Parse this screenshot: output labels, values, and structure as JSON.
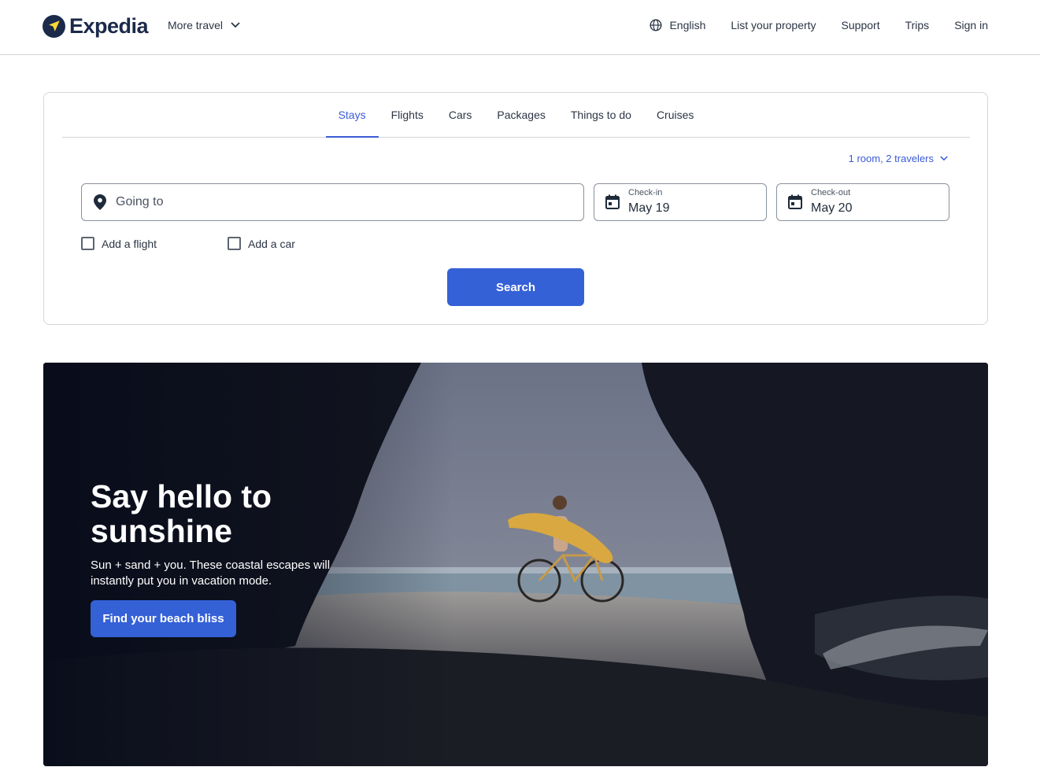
{
  "header": {
    "brand": "Expedia",
    "more_travel": "More travel",
    "nav": {
      "language": "English",
      "list_property": "List your property",
      "support": "Support",
      "trips": "Trips",
      "sign_in": "Sign in"
    }
  },
  "search": {
    "tabs": [
      "Stays",
      "Flights",
      "Cars",
      "Packages",
      "Things to do",
      "Cruises"
    ],
    "active_tab": "Stays",
    "travelers": "1 room, 2 travelers",
    "destination_placeholder": "Going to",
    "checkin": {
      "label": "Check-in",
      "value": "May 19"
    },
    "checkout": {
      "label": "Check-out",
      "value": "May 20"
    },
    "add_flight": "Add a flight",
    "add_car": "Add a car",
    "submit": "Search"
  },
  "hero": {
    "title": "Say hello to sunshine",
    "subtitle": "Sun + sand + you. These coastal escapes will instantly put you in vacation mode.",
    "cta": "Find your beach bliss"
  },
  "colors": {
    "brand_navy": "#1b2a4a",
    "accent_blue": "#3561d7",
    "link_blue": "#3b5bd6",
    "logo_yellow": "#fdd835"
  },
  "icons": [
    "chevron-down-icon",
    "globe-icon",
    "location-pin-icon",
    "calendar-icon",
    "plane-icon"
  ]
}
